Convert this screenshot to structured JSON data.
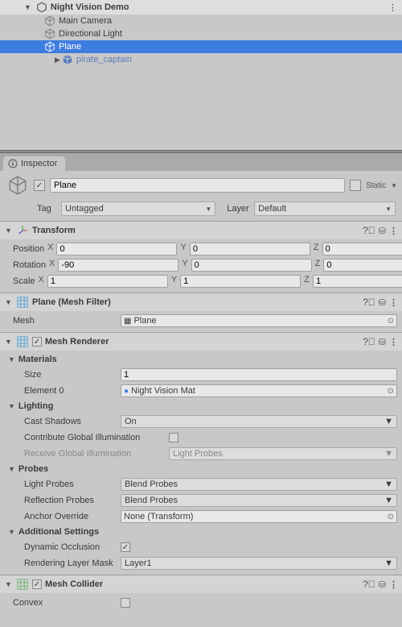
{
  "hierarchy": {
    "scene": "Night Vision Demo",
    "items": [
      "Main Camera",
      "Directional Light",
      "Plane",
      "pirate_captain"
    ]
  },
  "inspectorTab": "Inspector",
  "object": {
    "name": "Plane",
    "staticLabel": "Static",
    "tagLabel": "Tag",
    "tagValue": "Untagged",
    "layerLabel": "Layer",
    "layerValue": "Default"
  },
  "transform": {
    "title": "Transform",
    "positionLabel": "Position",
    "rotationLabel": "Rotation",
    "scaleLabel": "Scale",
    "pos": {
      "x": "0",
      "y": "0",
      "z": "0"
    },
    "rot": {
      "x": "-90",
      "y": "0",
      "z": "0"
    },
    "scl": {
      "x": "1",
      "y": "1",
      "z": "1"
    }
  },
  "meshFilter": {
    "title": "Plane (Mesh Filter)",
    "meshLabel": "Mesh",
    "meshValue": "Plane"
  },
  "meshRenderer": {
    "title": "Mesh Renderer",
    "materials": {
      "header": "Materials",
      "sizeLabel": "Size",
      "sizeValue": "1",
      "elemLabel": "Element 0",
      "elemValue": "Night Vision Mat"
    },
    "lighting": {
      "header": "Lighting",
      "castShadowsLabel": "Cast Shadows",
      "castShadowsValue": "On",
      "cgiLabel": "Contribute Global Illumination",
      "rgiLabel": "Receive Global Illumination",
      "rgiValue": "Light Probes"
    },
    "probes": {
      "header": "Probes",
      "lpLabel": "Light Probes",
      "lpValue": "Blend Probes",
      "rpLabel": "Reflection Probes",
      "rpValue": "Blend Probes",
      "aoLabel": "Anchor Override",
      "aoValue": "None (Transform)"
    },
    "additional": {
      "header": "Additional Settings",
      "doLabel": "Dynamic Occlusion",
      "rlmLabel": "Rendering Layer Mask",
      "rlmValue": "Layer1"
    }
  },
  "meshCollider": {
    "title": "Mesh Collider",
    "convexLabel": "Convex"
  }
}
